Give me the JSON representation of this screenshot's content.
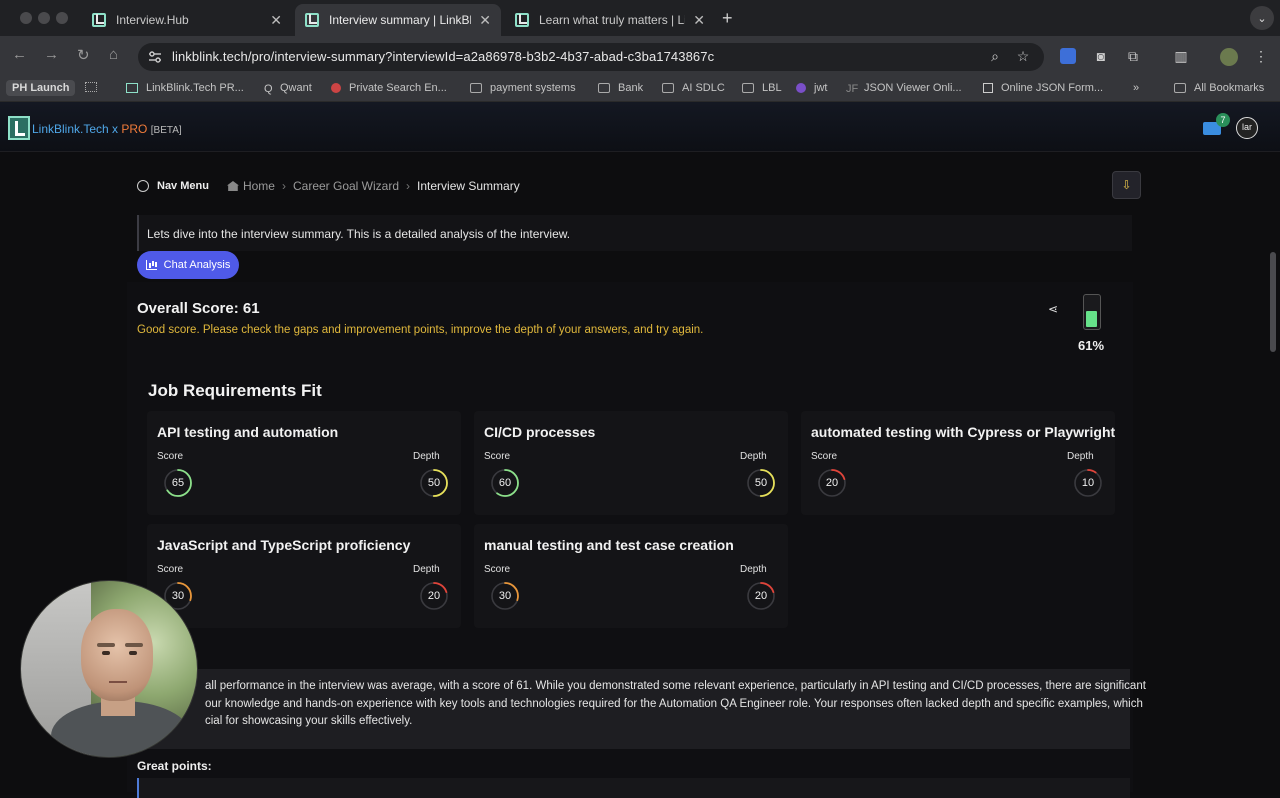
{
  "browser": {
    "tabs": [
      {
        "title": "Interview.Hub",
        "active": false
      },
      {
        "title": "Interview summary | LinkBlink",
        "active": true
      },
      {
        "title": "Learn what truly matters | Lin",
        "active": false
      }
    ],
    "url": "linkblink.tech/pro/interview-summary?interviewId=a2a86978-b3b2-4b37-abad-c3ba1743867c",
    "bookmarks": [
      "PH Launch",
      "LinkBlink.Tech PR...",
      "Qwant",
      "Private Search En...",
      "payment systems",
      "Bank",
      "AI SDLC",
      "LBL",
      "jwt",
      "JSON Viewer Onli...",
      "Online JSON Form..."
    ],
    "all_bookmarks": "All Bookmarks"
  },
  "app": {
    "brand": "LinkBlink.Tech",
    "brand_x": " x ",
    "brand_pro": "PRO",
    "brand_beta": "[BETA]",
    "mail_count": "7",
    "avatar_initials": "lar",
    "accent_color": "#4f5ae8"
  },
  "breadcrumb": {
    "nav_menu": "Nav Menu",
    "home": "Home",
    "wizard": "Career Goal Wizard",
    "current": "Interview Summary"
  },
  "intro": "Lets dive into the interview summary. This is a detailed analysis of the interview.",
  "chat_button": "Chat Analysis",
  "overall": {
    "title": "Overall Score: 61",
    "message": "Good score. Please check the gaps and improvement points, improve the depth of your answers, and try again.",
    "percent_label": "61%",
    "percent": 61
  },
  "job_fit": {
    "title": "Job Requirements Fit",
    "score_label": "Score",
    "depth_label": "Depth",
    "requirements": [
      {
        "name": "API testing and automation",
        "score": 65,
        "depth": 50
      },
      {
        "name": "CI/CD processes",
        "score": 60,
        "depth": 50
      },
      {
        "name": "automated testing with Cypress or Playwright",
        "score": 20,
        "depth": 10
      },
      {
        "name": "JavaScript and TypeScript proficiency",
        "score": 30,
        "depth": 20
      },
      {
        "name": "manual testing and test case creation",
        "score": 30,
        "depth": 20
      }
    ]
  },
  "summary": {
    "line1": "all performance in the interview was average, with a score of 61. While you demonstrated some relevant experience, particularly in API testing and CI/CD processes, there are significant",
    "line2": "our knowledge and hands-on experience with key tools and technologies required for the Automation QA Engineer role. Your responses often lacked depth and specific examples, which",
    "line3": "cial for showcasing your skills effectively."
  },
  "great_points": "Great points:"
}
